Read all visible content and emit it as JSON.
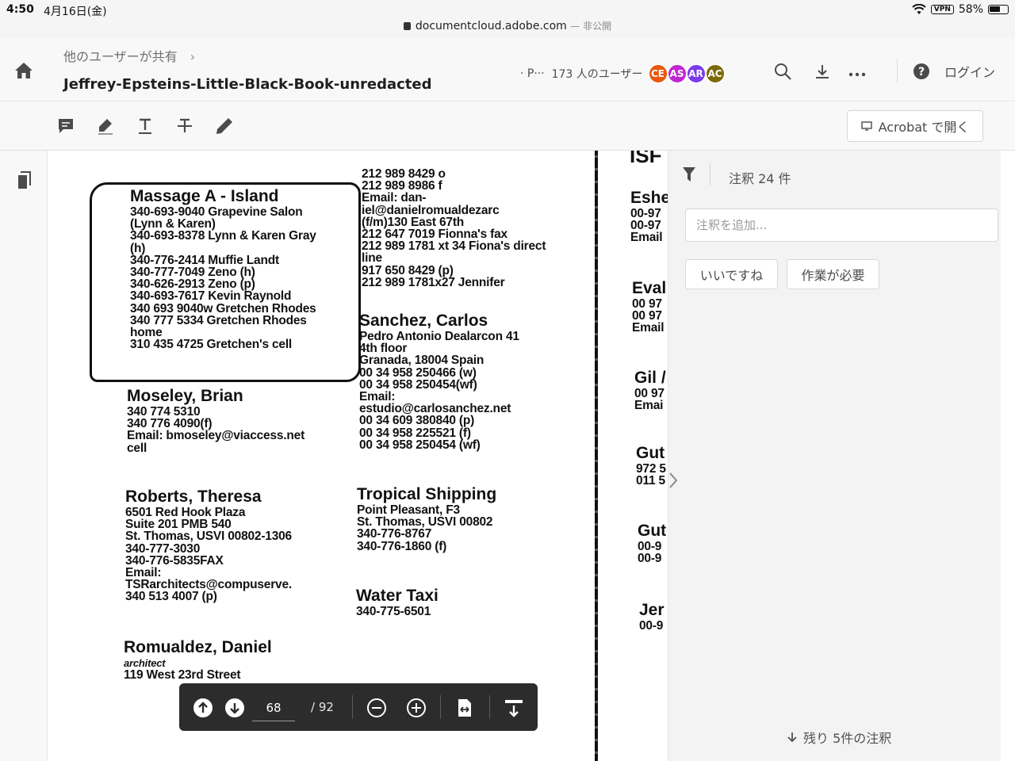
{
  "status_bar": {
    "time": "4:50",
    "date": "4月16日(金)",
    "url": "documentcloud.adobe.com",
    "privacy": "— 非公開",
    "vpn": "VPN",
    "battery": "58%"
  },
  "header": {
    "breadcrumb": "他のユーザーが共有",
    "breadcrumb_chevron": "›",
    "title": "Jeffrey-Epsteins-Little-Black-Book-unredacted",
    "users_prefix": "· P···",
    "users_label": "173 人のユーザー",
    "avatars": [
      {
        "initials": "CE",
        "color": "#e8590c"
      },
      {
        "initials": "AS",
        "color": "#c026d3"
      },
      {
        "initials": "AR",
        "color": "#7c3aed"
      },
      {
        "initials": "AC",
        "color": "#7c6a0a"
      }
    ],
    "login_label": "ログイン",
    "more_label": "•••"
  },
  "toolbar": {
    "open_in_acrobat": "Acrobat で開く"
  },
  "scan_left": {
    "box": {
      "title": "Massage A - Island",
      "lines": [
        "340-693-9040 Grapevine Salon",
        "(Lynn & Karen)",
        "340-693-8378 Lynn & Karen Gray",
        "(h)",
        "340-776-2414 Muffie Landt",
        "340-777-7049 Zeno (h)",
        "340-626-2913 Zeno (p)",
        "340-693-7617 Kevin Raynold",
        "340 693 9040w Gretchen Rhodes",
        "340 777 5334 Gretchen Rhodes",
        "home",
        "310 435 4725 Gretchen's cell"
      ]
    },
    "moseley": {
      "name": "Moseley, Brian",
      "lines": [
        "340 774 5310",
        "340 776 4090(f)",
        "Email: bmoseley@viaccess.net",
        "cell"
      ]
    },
    "roberts": {
      "name": "Roberts, Theresa",
      "lines": [
        "6501 Red Hook Plaza",
        "Suite 201 PMB 540",
        "St. Thomas, USVI 00802-1306",
        "340-777-3030",
        "340-776-5835FAX",
        "Email:",
        "TSRarchitects@compuserve.",
        "340 513 4007 (p)"
      ]
    },
    "romualdez": {
      "name": "Romualdez, Daniel",
      "role": "architect",
      "lines": [
        "119 West 23rd Street"
      ]
    }
  },
  "scan_mid": {
    "top_lines": [
      "212 989 8429 o",
      "212 989 8986 f",
      "Email: dan-",
      "iel@danielromualdezarc",
      "(f/m)130 East 67th",
      "212 647 7019 Fionna's fax",
      "212 989 1781 xt 34 Fiona's direct",
      "line",
      "917 650 8429 (p)",
      "212 989 1781x27 Jennifer"
    ],
    "sanchez": {
      "name": "Sanchez, Carlos",
      "lines": [
        "Pedro Antonio Dealarcon 41",
        "4th floor",
        "Granada, 18004 Spain",
        "00 34 958 250466 (w)",
        "00 34 958 250454(wf)",
        "Email:",
        "estudio@carlosanchez.net",
        "00 34 609 380840 (p)",
        "00 34 958 225521 (f)",
        "00 34 958 250454 (wf)"
      ]
    },
    "tropical": {
      "name": "Tropical Shipping",
      "lines": [
        "Point Pleasant, F3",
        "St. Thomas, USVI 00802",
        "340-776-8767",
        "340-776-1860 (f)"
      ]
    },
    "water_taxi": {
      "name": "Water Taxi",
      "lines": [
        "340-775-6501"
      ]
    }
  },
  "scan_right": {
    "top": "ISF",
    "entries": [
      {
        "name": "Eshe",
        "lines": [
          "00-97",
          "00-97",
          "Email"
        ]
      },
      {
        "name": "Eval",
        "lines": [
          "00 97",
          "00 97",
          "Email"
        ]
      },
      {
        "name": "Gil /",
        "lines": [
          "00 97",
          "Emai"
        ]
      },
      {
        "name": "Gut",
        "lines": [
          "972 5",
          "011 5"
        ]
      },
      {
        "name": "Gut",
        "lines": [
          "00-9",
          "00-9"
        ]
      },
      {
        "name": "Jer",
        "lines": [
          "00-9"
        ]
      }
    ]
  },
  "comments": {
    "count_label": "注釈 24 件",
    "add_placeholder": "注釈を追加...",
    "like_button": "いいですね",
    "needs_work_button": "作業が必要",
    "remaining_label": "残り 5件の注釈"
  },
  "pager": {
    "current_page": "68",
    "total_pages": "/ 92"
  }
}
